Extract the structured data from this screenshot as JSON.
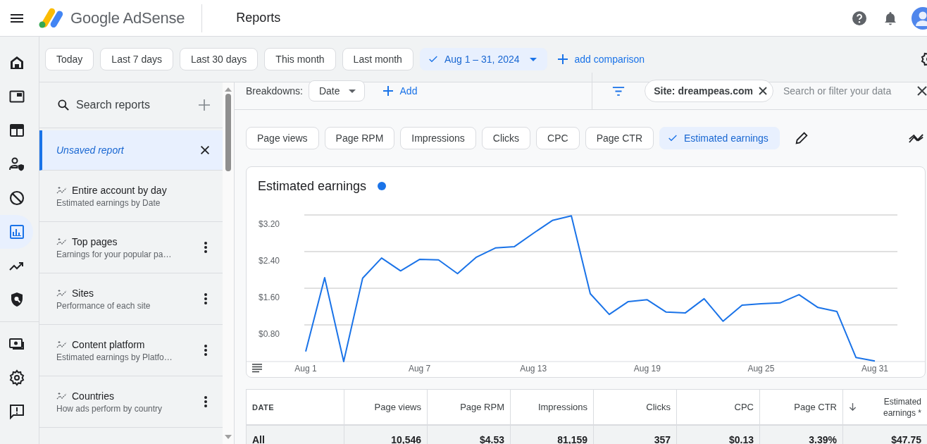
{
  "header": {
    "product": "Google AdSense",
    "title": "Reports"
  },
  "nav_rail": [
    {
      "kind": "home",
      "selected": false
    },
    {
      "kind": "ads",
      "selected": false
    },
    {
      "kind": "layout",
      "selected": false
    },
    {
      "kind": "people",
      "selected": false
    },
    {
      "kind": "block",
      "selected": false
    },
    {
      "kind": "reports",
      "selected": true
    },
    {
      "kind": "trend",
      "selected": false
    },
    {
      "kind": "shield",
      "selected": false
    },
    {
      "kind": "divider"
    },
    {
      "kind": "payments",
      "selected": false
    },
    {
      "kind": "settings",
      "selected": false
    },
    {
      "kind": "feedback",
      "selected": false
    }
  ],
  "date_ranges": [
    {
      "label": "Today",
      "selected": false
    },
    {
      "label": "Last 7 days",
      "selected": false
    },
    {
      "label": "Last 30 days",
      "selected": false
    },
    {
      "label": "This month",
      "selected": false
    },
    {
      "label": "Last month",
      "selected": false
    },
    {
      "label": "Aug 1 – 31, 2024",
      "selected": true
    }
  ],
  "add_comparison": "add comparison",
  "breakdowns": {
    "label": "Breakdowns:",
    "value": "Date",
    "add": "Add"
  },
  "filter": {
    "chip": "Site: dreampeas.com",
    "placeholder": "Search or filter your data"
  },
  "reports": {
    "search_placeholder": "Search reports",
    "current": {
      "title": "Unsaved report",
      "selected": true
    },
    "items": [
      {
        "title": "Entire account by day",
        "subtitle": "Estimated earnings by Date",
        "menu": false
      },
      {
        "title": "Top pages",
        "subtitle": "Earnings for your popular pa…",
        "menu": true
      },
      {
        "title": "Sites",
        "subtitle": "Performance of each site",
        "menu": true
      },
      {
        "title": "Content platform",
        "subtitle": "Estimated earnings by Platfo…",
        "menu": true
      },
      {
        "title": "Countries",
        "subtitle": "How ads perform by country",
        "menu": true
      }
    ]
  },
  "metrics": [
    {
      "label": "Page views",
      "selected": false
    },
    {
      "label": "Page RPM",
      "selected": false
    },
    {
      "label": "Impressions",
      "selected": false
    },
    {
      "label": "Clicks",
      "selected": false
    },
    {
      "label": "CPC",
      "selected": false
    },
    {
      "label": "Page CTR",
      "selected": false
    },
    {
      "label": "Estimated earnings",
      "selected": true
    }
  ],
  "chart": {
    "chart_data": {
      "type": "line",
      "categories": [
        "Aug 1",
        null,
        null,
        null,
        null,
        null,
        "Aug 7",
        null,
        null,
        null,
        null,
        null,
        "Aug 13",
        null,
        null,
        null,
        null,
        null,
        "Aug 19",
        null,
        null,
        null,
        null,
        null,
        "Aug 25",
        null,
        null,
        null,
        null,
        null,
        "Aug 31"
      ],
      "series": [
        {
          "name": "Estimated earnings",
          "color": "#1a73e8",
          "values": [
            0.22,
            1.83,
            0,
            1.82,
            2.26,
            1.98,
            2.23,
            2.22,
            1.92,
            2.28,
            2.48,
            2.51,
            2.8,
            3.08,
            3.18,
            1.48,
            1.03,
            1.31,
            1.35,
            1.08,
            1.06,
            1.37,
            0.88,
            1.23,
            1.26,
            1.28,
            1.46,
            1.18,
            1.09,
            0.09,
            0.01
          ]
        }
      ],
      "ylim": [
        0,
        3.2
      ],
      "grid": true,
      "yticks": [
        {
          "value": 0.8,
          "label": "$0.80"
        },
        {
          "value": 1.6,
          "label": "$1.60"
        },
        {
          "value": 2.4,
          "label": "$2.40"
        },
        {
          "value": 3.2,
          "label": "$3.20"
        }
      ]
    }
  },
  "table": {
    "columns": [
      {
        "label": "DATE",
        "sorted": false
      },
      {
        "label": "Page views",
        "sorted": false
      },
      {
        "label": "Page RPM",
        "sorted": false
      },
      {
        "label": "Impressions",
        "sorted": false
      },
      {
        "label": "Clicks",
        "sorted": false
      },
      {
        "label": "CPC",
        "sorted": false
      },
      {
        "label": "Page CTR",
        "sorted": false
      },
      {
        "label": "Estimated earnings *",
        "sorted": true
      }
    ],
    "rows": [
      [
        "All",
        "10,546",
        "$4.53",
        "81,159",
        "357",
        "$0.13",
        "3.39%",
        "$47.75"
      ]
    ]
  }
}
